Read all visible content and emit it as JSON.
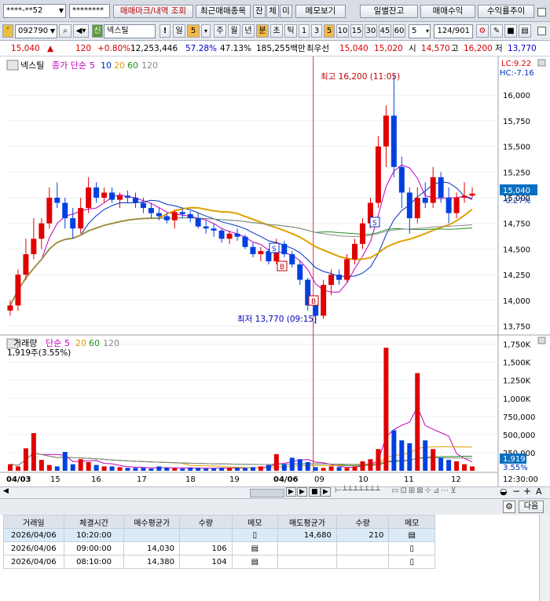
{
  "toolbar1": {
    "account": "****-**52",
    "password": "********",
    "buttons": [
      "매매마크/내역 조회",
      "최근매매종목",
      "잔",
      "체",
      "미",
      "메모보기",
      "일별잔고",
      "매매수익",
      "수익률추이"
    ]
  },
  "toolbar2": {
    "code": "092790",
    "stock_badge": "신",
    "stock_name": "넥스틸",
    "period_num": "5",
    "period_tabs": [
      "주",
      "월",
      "년",
      "분",
      "초",
      "틱"
    ],
    "intervals": [
      "1",
      "3",
      "5",
      "10",
      "15",
      "30",
      "45",
      "60"
    ],
    "count": "5",
    "paging": "124/901",
    "active_tab": "분",
    "active_interval": "5"
  },
  "quote": {
    "price": "15,040",
    "change": "120",
    "change_pct": "+0.80%",
    "volume": "12,253,446",
    "ratio1": "57.28%",
    "ratio2": "47.13%",
    "amount": "185,255백만",
    "priority": "최우선",
    "ask": "15,040",
    "bid": "15,020",
    "open_label": "시",
    "open": "14,570",
    "high_label": "고",
    "high": "16,200",
    "low_label": "저",
    "low": "13,770"
  },
  "price_pane": {
    "title": "넥스틸",
    "legend_label": "종가 단순",
    "ma": [
      "5",
      "10",
      "20",
      "60",
      "120"
    ],
    "lc": "LC:9.22",
    "hc": "HC:-7.16",
    "yticks": [
      "16,000",
      "15,750",
      "15,500",
      "15,250",
      "15,000",
      "14,750",
      "14,500",
      "14,250",
      "14,000",
      "13,750"
    ],
    "cur_price": "15,040",
    "cur_pct": "-0.27%",
    "high_note": "최고 16,200 (11:05)",
    "low_note": "최저 13,770 (09:15)",
    "markers": [
      "S",
      "B",
      "B",
      "S"
    ]
  },
  "volume_pane": {
    "title": "거래량",
    "legend_label": "단순",
    "ma": [
      "5",
      "20",
      "60",
      "120"
    ],
    "info": "1,919주(3.55%)",
    "yticks": [
      "1,750K",
      "1,500K",
      "1,250K",
      "1,000K",
      "750,000",
      "500,000",
      "250,000"
    ],
    "cur": "1,919",
    "cur_pct": "3.55%"
  },
  "xaxis": {
    "labels": [
      "04/03",
      "15",
      "16",
      "17",
      "18",
      "19",
      "04/06",
      "09",
      "10",
      "11",
      "12"
    ],
    "time": "12:30:00"
  },
  "memo_panel": {
    "next_button": "다음"
  },
  "memo_table": {
    "headers": [
      "거래일",
      "체결시간",
      "매수평균가",
      "수량",
      "메모",
      "매도평균가",
      "수량",
      "메모"
    ],
    "rows": [
      [
        "2026/04/06",
        "10:20:00",
        "",
        "",
        "",
        "14,680",
        "210",
        ""
      ],
      [
        "2026/04/06",
        "09:00:00",
        "14,030",
        "106",
        "",
        "",
        "",
        ""
      ],
      [
        "2026/04/06",
        "08:10:00",
        "14,380",
        "104",
        "",
        "",
        "",
        ""
      ]
    ]
  },
  "chart_data": {
    "type": "candlestick",
    "note": "5-minute candles; estimated OHLC read from price axis",
    "y_range": [
      13700,
      16300
    ],
    "candles": [
      [
        13900,
        14000,
        13850,
        13950
      ],
      [
        13950,
        14300,
        13900,
        14250
      ],
      [
        14250,
        14600,
        14200,
        14450
      ],
      [
        14450,
        14800,
        14400,
        14600
      ],
      [
        14600,
        14800,
        14500,
        14750
      ],
      [
        14750,
        15100,
        14700,
        15000
      ],
      [
        15000,
        15150,
        14900,
        14950
      ],
      [
        14950,
        15000,
        14700,
        14800
      ],
      [
        14800,
        14900,
        14600,
        14700
      ],
      [
        14700,
        15000,
        14650,
        14900
      ],
      [
        14900,
        15200,
        14850,
        15100
      ],
      [
        15100,
        15150,
        14950,
        15000
      ],
      [
        15000,
        15100,
        14950,
        15050
      ],
      [
        15050,
        15100,
        14950,
        14980
      ],
      [
        14980,
        15050,
        14900,
        15020
      ],
      [
        15020,
        15070,
        14950,
        15000
      ],
      [
        15000,
        15050,
        14900,
        14950
      ],
      [
        14950,
        15000,
        14850,
        14900
      ],
      [
        14900,
        14950,
        14800,
        14850
      ],
      [
        14850,
        14900,
        14780,
        14820
      ],
      [
        14820,
        14850,
        14750,
        14780
      ],
      [
        14780,
        14880,
        14700,
        14860
      ],
      [
        14860,
        14900,
        14800,
        14840
      ],
      [
        14840,
        14870,
        14760,
        14800
      ],
      [
        14800,
        14850,
        14700,
        14720
      ],
      [
        14720,
        14780,
        14650,
        14700
      ],
      [
        14700,
        14750,
        14620,
        14680
      ],
      [
        14680,
        14700,
        14560,
        14600
      ],
      [
        14600,
        14680,
        14550,
        14650
      ],
      [
        14650,
        14700,
        14580,
        14620
      ],
      [
        14620,
        14640,
        14500,
        14520
      ],
      [
        14520,
        14560,
        14420,
        14450
      ],
      [
        14450,
        14520,
        14380,
        14480
      ],
      [
        14480,
        14500,
        14350,
        14380
      ],
      [
        14380,
        14600,
        14350,
        14550
      ],
      [
        14550,
        14580,
        14420,
        14450
      ],
      [
        14450,
        14480,
        14320,
        14350
      ],
      [
        14350,
        14380,
        14150,
        14200
      ],
      [
        14200,
        14220,
        13900,
        13950
      ],
      [
        13950,
        14000,
        13770,
        13850
      ],
      [
        13850,
        14200,
        13820,
        14150
      ],
      [
        14150,
        14300,
        14050,
        14250
      ],
      [
        14250,
        14300,
        14150,
        14200
      ],
      [
        14200,
        14450,
        14180,
        14400
      ],
      [
        14400,
        14600,
        14350,
        14550
      ],
      [
        14550,
        14800,
        14500,
        14750
      ],
      [
        14750,
        15000,
        14700,
        14950
      ],
      [
        14950,
        15600,
        14900,
        15500
      ],
      [
        15500,
        15900,
        15300,
        15800
      ],
      [
        15800,
        16200,
        15200,
        15300
      ],
      [
        15300,
        15400,
        14900,
        15050
      ],
      [
        15050,
        15100,
        14650,
        14800
      ],
      [
        14800,
        15100,
        14750,
        15000
      ],
      [
        15000,
        15150,
        14900,
        14950
      ],
      [
        14950,
        15300,
        14900,
        15200
      ],
      [
        15200,
        15250,
        14950,
        15000
      ],
      [
        15000,
        15100,
        14750,
        14850
      ],
      [
        14850,
        15050,
        14800,
        15000
      ],
      [
        15000,
        15150,
        14950,
        15020
      ],
      [
        15020,
        15100,
        15000,
        15040
      ]
    ],
    "volume_K": [
      90,
      60,
      310,
      520,
      150,
      80,
      60,
      260,
      90,
      160,
      120,
      80,
      60,
      60,
      50,
      40,
      40,
      40,
      30,
      60,
      40,
      35,
      30,
      40,
      40,
      30,
      35,
      40,
      40,
      40,
      40,
      50,
      60,
      80,
      230,
      90,
      180,
      160,
      120,
      50,
      40,
      60,
      50,
      40,
      60,
      130,
      160,
      300,
      1700,
      560,
      420,
      380,
      1350,
      420,
      300,
      180,
      150,
      130,
      90,
      60
    ]
  }
}
